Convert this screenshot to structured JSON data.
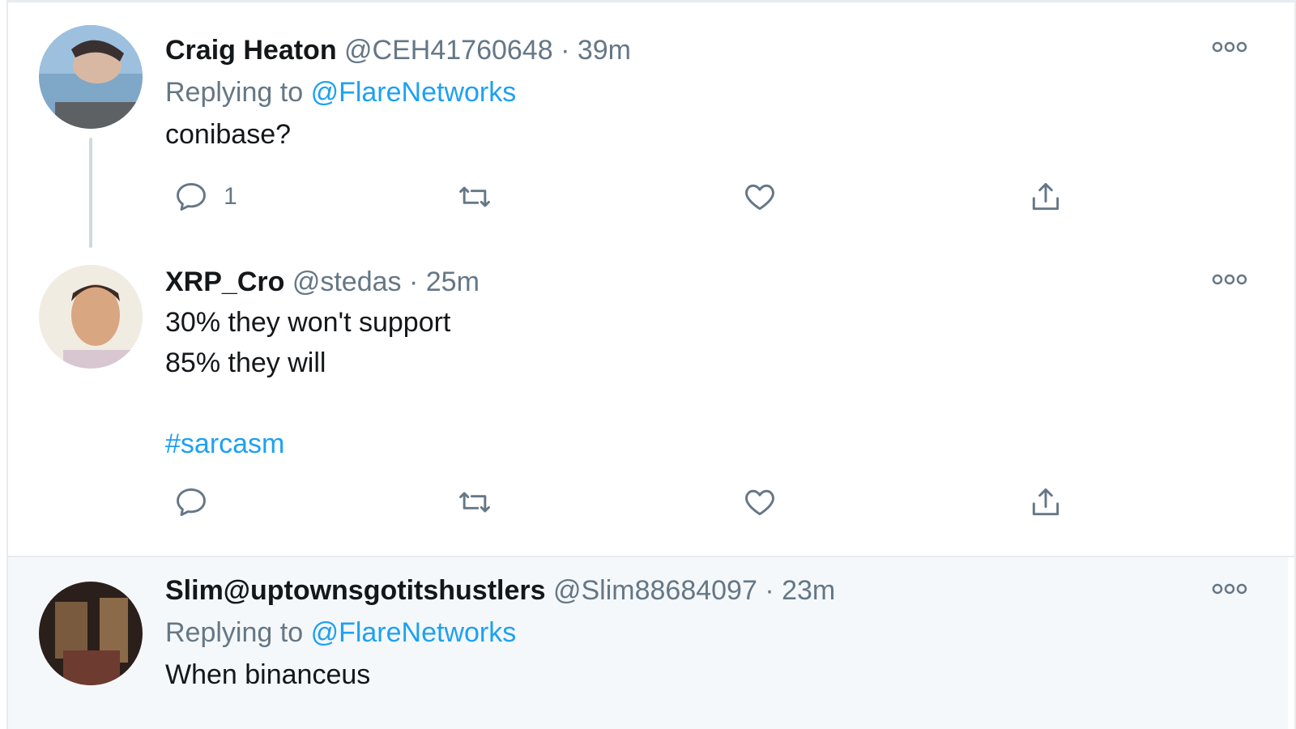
{
  "tweets": [
    {
      "name": "Craig Heaton",
      "handle": "@CEH41760648",
      "separator": "·",
      "time": "39m",
      "replying_prefix": "Replying to",
      "replying_to": "@FlareNetworks",
      "text_lines": [
        "conibase?"
      ],
      "reply_count": "1",
      "avatar_icon": "avatar-photo"
    },
    {
      "name": "XRP_Cro",
      "handle": "@stedas",
      "separator": "·",
      "time": "25m",
      "text_lines": [
        "30% they won't support",
        "85% they will"
      ],
      "hashtag": "#sarcasm",
      "avatar_icon": "avatar-photo"
    },
    {
      "name": "Slim@uptownsgotitshustlers",
      "handle": "@Slim88684097",
      "separator": "·",
      "time": "23m",
      "replying_prefix": "Replying to",
      "replying_to": "@FlareNetworks",
      "text_lines": [
        "When binanceus"
      ],
      "avatar_icon": "avatar-photo"
    }
  ],
  "icons": {
    "more": "more-options-icon",
    "reply": "reply-icon",
    "retweet": "retweet-icon",
    "like": "like-icon",
    "share": "share-icon"
  },
  "colors": {
    "link": "#1da1f2",
    "secondary_text": "#657786",
    "primary_text": "#14171a",
    "border": "#e6ecf0",
    "highlight_bg": "#f5f8fa"
  }
}
